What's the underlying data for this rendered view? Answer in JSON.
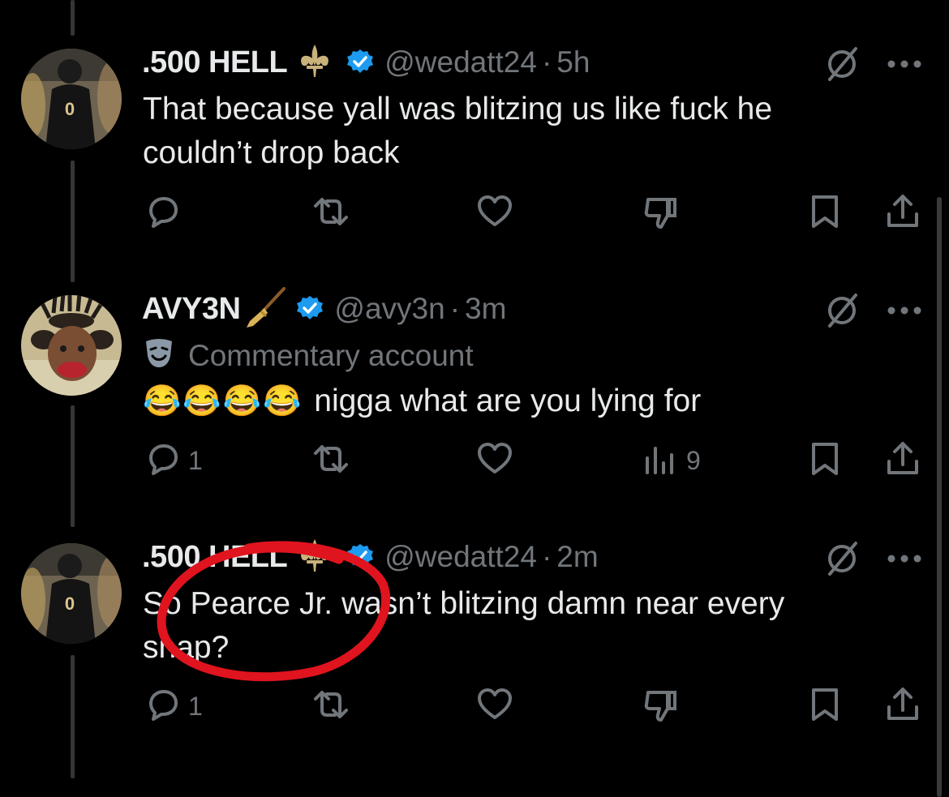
{
  "tweets": [
    {
      "display_name": ".500 HELL",
      "handle": "@wedatt24",
      "separator": "·",
      "time": "5h",
      "text": "That because yall was blitzing us like fuck he couldn’t drop back",
      "reply_count": "",
      "analytics_count": ""
    },
    {
      "display_name": "AVY3N",
      "handle": "@avy3n",
      "separator": "·",
      "time": "3m",
      "label": "Commentary account",
      "emojis": "😂😂😂😂",
      "text": "nigga what are you lying for",
      "reply_count": "1",
      "analytics_count": "9"
    },
    {
      "display_name": ".500 HELL",
      "handle": "@wedatt24",
      "separator": "·",
      "time": "2m",
      "text": "So Pearce Jr. wasn’t blitzing damn near every snap?",
      "reply_count": "1",
      "analytics_count": ""
    }
  ],
  "icons": [
    "reply-icon",
    "retweet-icon",
    "like-icon",
    "dislike-icon",
    "analytics-icon",
    "bookmark-icon",
    "share-icon",
    "grok-icon",
    "more-icon",
    "verified-icon",
    "fleur-de-lis-icon",
    "broom-icon",
    "theater-mask-icon"
  ],
  "colors": {
    "background": "#000000",
    "text": "#e7e9ea",
    "muted": "#71767b",
    "verified": "#1d9bf0",
    "annotation": "#e0141e",
    "fleur": "#c9b27c"
  }
}
